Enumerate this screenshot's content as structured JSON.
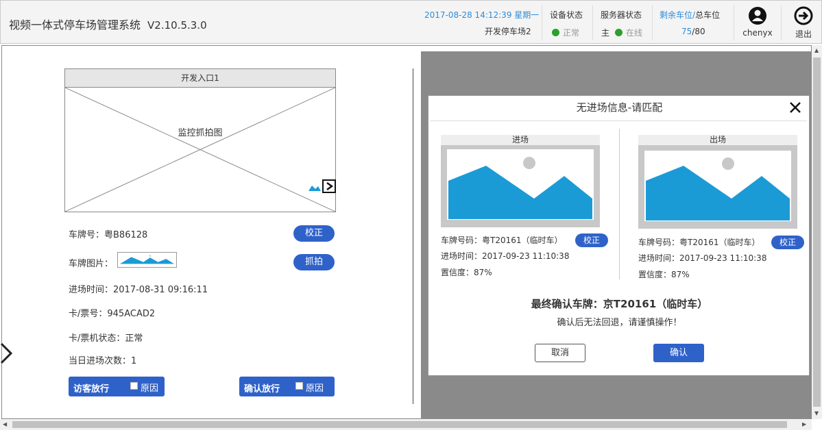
{
  "header": {
    "app_title": "视频一体式停车场管理系统",
    "version": "V2.10.5.3.0",
    "datetime": "2017-08-28 14:12:39 星期一",
    "lot_name": "开发停车场2",
    "device_status_title": "设备状态",
    "device_status_value": "正常",
    "server_status_title": "服务器状态",
    "server_role": "主",
    "server_status_value": "在线",
    "spaces_title_remaining": "剩余车位",
    "spaces_title_sep": "/",
    "spaces_title_total": "总车位",
    "spaces_remaining": "75",
    "spaces_total": "/80",
    "username": "chenyx",
    "logout_label": "退出",
    "status_ok_color": "#2ca02c",
    "accent_color": "#2e8bd8"
  },
  "camera": {
    "title": "开发入口1",
    "placeholder": "监控抓拍图"
  },
  "entry_info": {
    "plate_label": "车牌号：",
    "plate_value": "粤B86128",
    "correct_button": "校正",
    "plate_image_label": "车牌图片：",
    "capture_button": "抓拍",
    "entry_time_label": "进场时间：",
    "entry_time_value": "2017-08-31 09:16:11",
    "card_label": "卡/票号：",
    "card_value": "945ACAD2",
    "card_status_label": "卡/票机状态：",
    "card_status_value": "正常",
    "daily_count_label": "当日进场次数：",
    "daily_count_value": "1"
  },
  "release": {
    "visitor_label": "访客放行",
    "confirm_label": "确认放行",
    "reason_label": "原因"
  },
  "dialog": {
    "title": "无进场信息-请匹配",
    "entry_panel": {
      "head": "进场",
      "plate_line": "车牌号码：粤T20161（临时车）",
      "time_line": "进场时间：2017-09-23  11:10:38",
      "confidence_line": "置信度：87%",
      "correct_button": "校正"
    },
    "exit_panel": {
      "head": "出场",
      "plate_line": "车牌号码：粤T20161（临时车）",
      "time_line": "进场时间：2017-09-23  11:10:38",
      "confidence_line": "置信度：87%",
      "correct_button": "校正"
    },
    "final_plate": "最终确认车牌：京T20161（临时车）",
    "warning": "确认后无法回退，请谨慎操作！",
    "cancel_button": "取消",
    "confirm_button": "确认"
  },
  "icons": {
    "user": "user-icon",
    "logout": "logout-icon",
    "close": "close-icon",
    "play": "play-icon",
    "image": "image-icon",
    "left_arrow": "chevron-left-icon"
  },
  "brand_button_color": "#2f62c9"
}
